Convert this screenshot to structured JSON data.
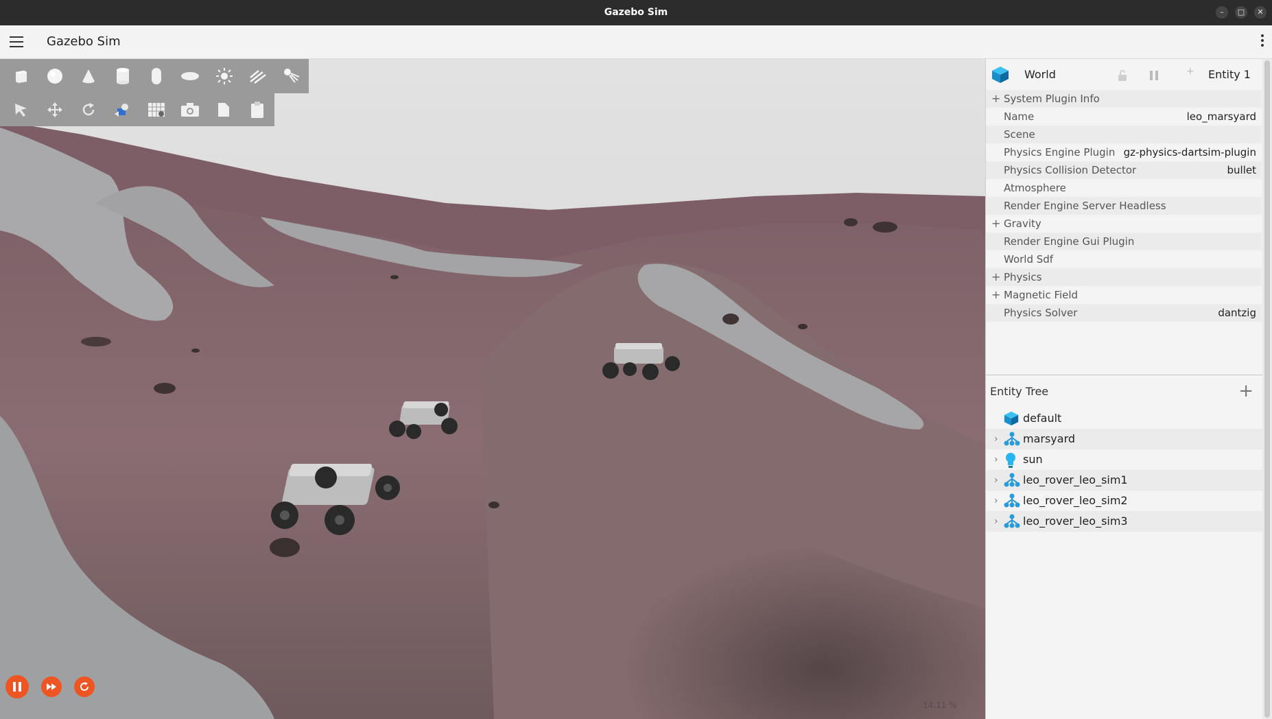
{
  "os_window": {
    "title": "Gazebo Sim",
    "min_icon": "minimize-icon",
    "max_icon": "maximize-icon",
    "close_icon": "close-icon"
  },
  "app_header": {
    "title": "Gazebo Sim",
    "menu_icon": "hamburger-menu-icon",
    "more_icon": "kebab-menu-icon"
  },
  "shape_toolbar": [
    "box-icon",
    "sphere-icon",
    "cone-icon",
    "cylinder-icon",
    "capsule-icon",
    "ellipsoid-icon",
    "point-light-icon",
    "directional-light-icon",
    "spot-light-icon"
  ],
  "tool_toolbar": [
    "select-icon",
    "translate-icon",
    "rotate-icon",
    "transform-control-icon",
    "grid-snap-icon",
    "screenshot-icon",
    "copy-icon",
    "paste-icon"
  ],
  "playback": {
    "pause_icon": "pause-icon",
    "step_icon": "step-forward-icon",
    "reset_icon": "reset-icon"
  },
  "viewport": {
    "zoom_readout": "14.11 %"
  },
  "component_inspector": {
    "entity_type": "World",
    "entity_label": "Entity 1",
    "rows": [
      {
        "expandable": true,
        "label": "System Plugin Info",
        "value": ""
      },
      {
        "expandable": false,
        "label": "Name",
        "value": "leo_marsyard"
      },
      {
        "expandable": false,
        "label": "Scene",
        "value": ""
      },
      {
        "expandable": false,
        "label": "Physics Engine Plugin",
        "value": "gz-physics-dartsim-plugin"
      },
      {
        "expandable": false,
        "label": "Physics Collision Detector",
        "value": "bullet"
      },
      {
        "expandable": false,
        "label": "Atmosphere",
        "value": ""
      },
      {
        "expandable": false,
        "label": "Render Engine Server Headless",
        "value": ""
      },
      {
        "expandable": true,
        "label": "Gravity",
        "value": ""
      },
      {
        "expandable": false,
        "label": "Render Engine Gui Plugin",
        "value": ""
      },
      {
        "expandable": false,
        "label": "World Sdf",
        "value": ""
      },
      {
        "expandable": true,
        "label": "Physics",
        "value": ""
      },
      {
        "expandable": true,
        "label": "Magnetic Field",
        "value": ""
      },
      {
        "expandable": false,
        "label": "Physics Solver",
        "value": "dantzig"
      }
    ]
  },
  "entity_tree": {
    "title": "Entity Tree",
    "add_icon": "add-icon",
    "items": [
      {
        "label": "default",
        "icon": "world-cube-icon",
        "expandable": false
      },
      {
        "label": "marsyard",
        "icon": "model-icon",
        "expandable": true
      },
      {
        "label": "sun",
        "icon": "light-bulb-icon",
        "expandable": true
      },
      {
        "label": "leo_rover_leo_sim1",
        "icon": "model-icon",
        "expandable": true
      },
      {
        "label": "leo_rover_leo_sim2",
        "icon": "model-icon",
        "expandable": true
      },
      {
        "label": "leo_rover_leo_sim3",
        "icon": "model-icon",
        "expandable": true
      }
    ]
  },
  "colors": {
    "accent": "#ee5522",
    "entity_blue": "#1a9ed8",
    "terrain": "#8a6a70",
    "sky": "#dcdcdc"
  }
}
